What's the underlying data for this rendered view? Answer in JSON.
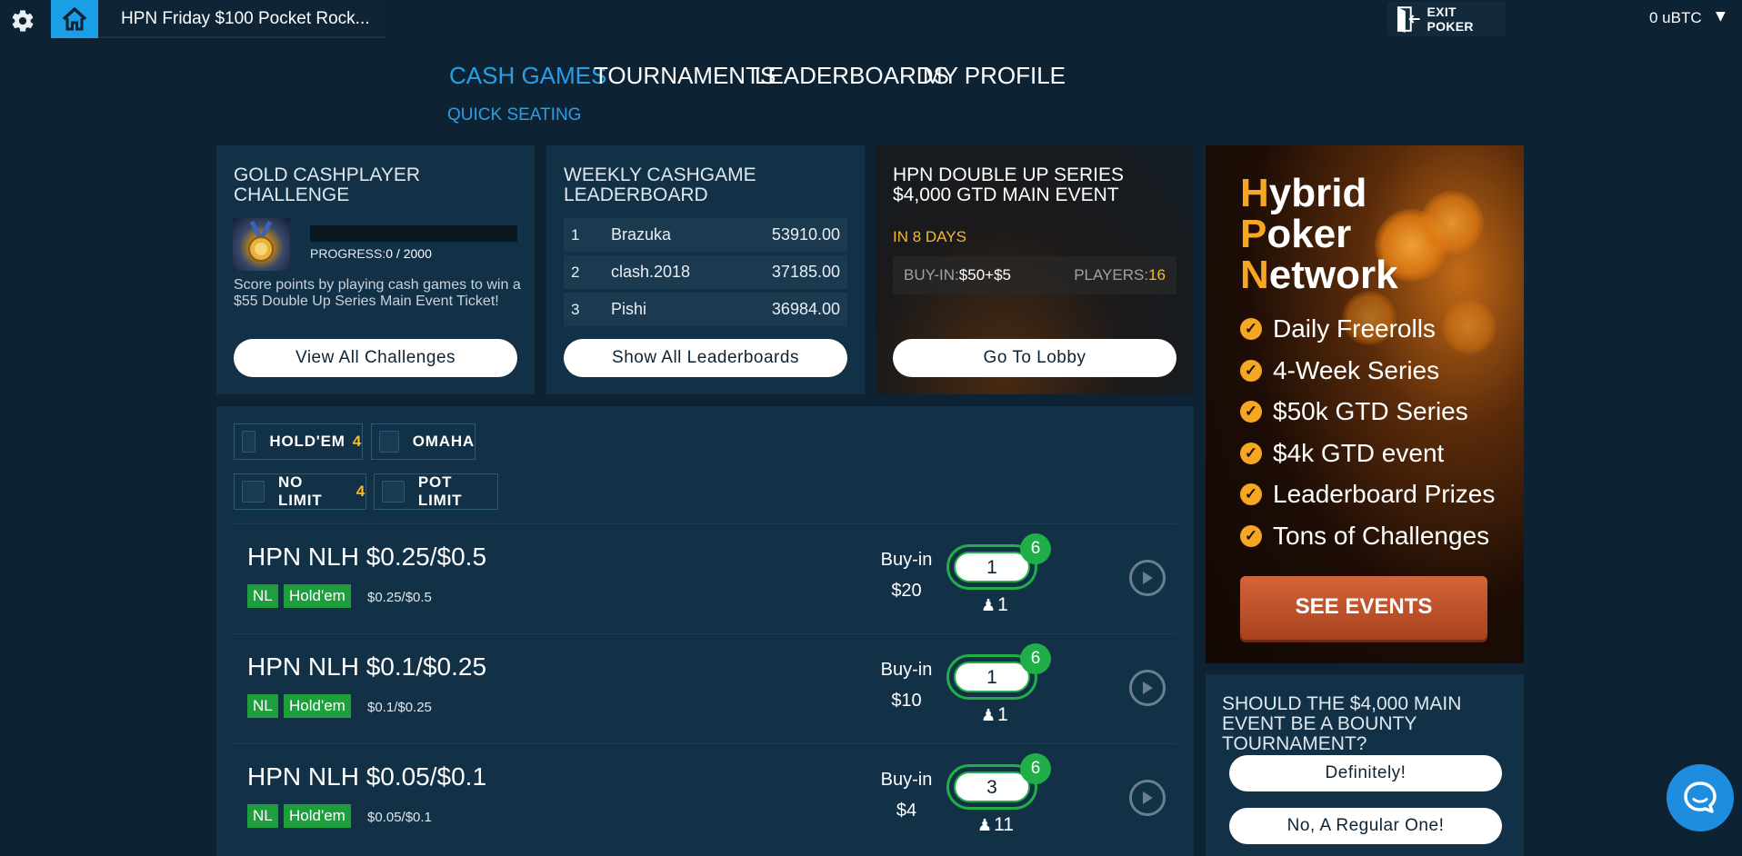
{
  "topbar": {
    "tab_title": "HPN Friday $100 Pocket Rock...",
    "exit_label": "EXIT POKER",
    "balance": "0 uBTC"
  },
  "nav": {
    "items": [
      "CASH GAMES",
      "TOURNAMENTS",
      "LEADERBOARDS",
      "MY PROFILE"
    ],
    "active": "CASH GAMES",
    "sub": "QUICK SEATING"
  },
  "challenge": {
    "title": "GOLD CASHPLAYER CHALLENGE",
    "progress_label": "PROGRESS:",
    "progress_value": "0 / 2000",
    "progress_fraction": 0,
    "description": "Score points by playing cash games to win a $55 Double Up Series Main Event Ticket!",
    "button": "View All Challenges"
  },
  "leaderboard": {
    "title": "WEEKLY CASHGAME LEADERBOARD",
    "rows": [
      {
        "rank": "1",
        "name": "Brazuka",
        "score": "53910.00"
      },
      {
        "rank": "2",
        "name": "clash.2018",
        "score": "37185.00"
      },
      {
        "rank": "3",
        "name": "Pishi",
        "score": "36984.00"
      }
    ],
    "button": "Show All Leaderboards"
  },
  "event": {
    "title": "HPN DOUBLE UP SERIES $4,000 GTD MAIN EVENT",
    "countdown": "IN 8 DAYS",
    "buyin_label": "BUY-IN:",
    "buyin_value": "$50+$5",
    "players_label": "PLAYERS:",
    "players_value": "16",
    "button": "Go To Lobby"
  },
  "filters": [
    {
      "label": "HOLD'EM",
      "count": "4"
    },
    {
      "label": "OMAHA",
      "count": ""
    },
    {
      "label": "NO LIMIT",
      "count": "4"
    },
    {
      "label": "POT LIMIT",
      "count": ""
    }
  ],
  "games": [
    {
      "name": "HPN NLH $0.25/$0.5",
      "tags": [
        "NL",
        "Hold'em"
      ],
      "stakes": "$0.25/$0.5",
      "buyin_label": "Buy-in",
      "buyin": "$20",
      "seated": "1",
      "max_seats": "6",
      "players": "1"
    },
    {
      "name": "HPN NLH $0.1/$0.25",
      "tags": [
        "NL",
        "Hold'em"
      ],
      "stakes": "$0.1/$0.25",
      "buyin_label": "Buy-in",
      "buyin": "$10",
      "seated": "1",
      "max_seats": "6",
      "players": "1"
    },
    {
      "name": "HPN NLH $0.05/$0.1",
      "tags": [
        "NL",
        "Hold'em"
      ],
      "stakes": "$0.05/$0.1",
      "buyin_label": "Buy-in",
      "buyin": "$4",
      "seated": "3",
      "max_seats": "6",
      "players": "11"
    }
  ],
  "ad": {
    "title_lines": [
      {
        "first": "H",
        "rest": "ybrid"
      },
      {
        "first": "P",
        "rest": "oker"
      },
      {
        "first": "N",
        "rest": "etwork"
      }
    ],
    "items": [
      "Daily Freerolls",
      "4-Week Series",
      "$50k GTD Series",
      "$4k GTD event",
      "Leaderboard Prizes",
      "Tons of Challenges"
    ],
    "button": "SEE EVENTS",
    "accent_color": "#f5a623"
  },
  "poll": {
    "question": "SHOULD THE $4,000 MAIN EVENT BE A BOUNTY TOURNAMENT?",
    "options": [
      "Definitely!",
      "No, A Regular One!"
    ]
  },
  "colors": {
    "background": "#0d2334",
    "card": "#123046",
    "accent_blue": "#2a9ee8",
    "green": "#1fae47",
    "gold": "#f5b82e"
  }
}
